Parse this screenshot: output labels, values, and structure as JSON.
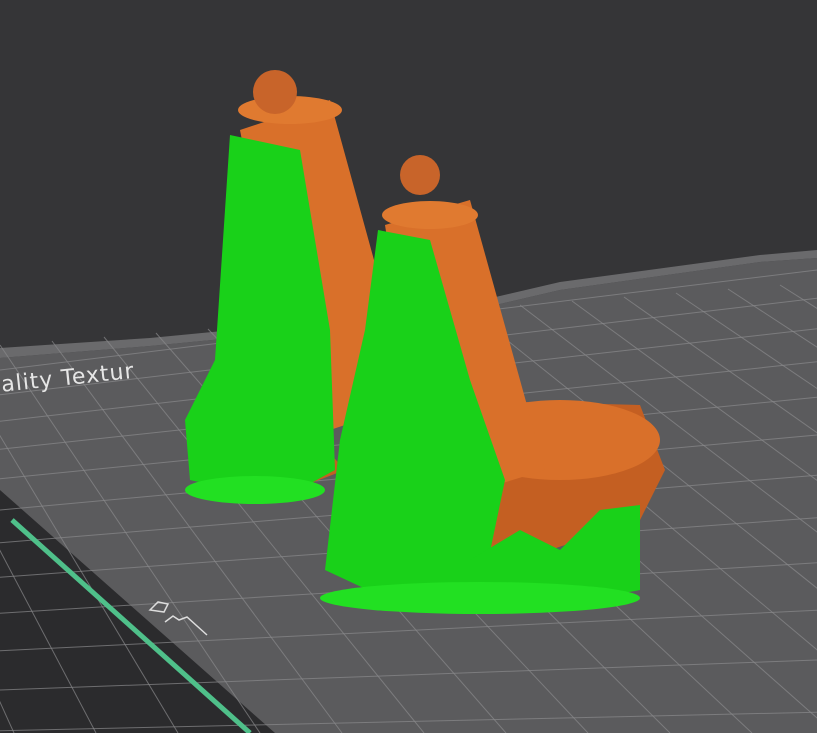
{
  "viewport": {
    "bed_label": "ality Textur",
    "colors": {
      "background": "#353537",
      "bed": "#5b5b5d",
      "grid": "#8a8a8c",
      "support": "#19d119",
      "model": "#d9702a",
      "edge_stripe": "#4fc08a"
    }
  }
}
